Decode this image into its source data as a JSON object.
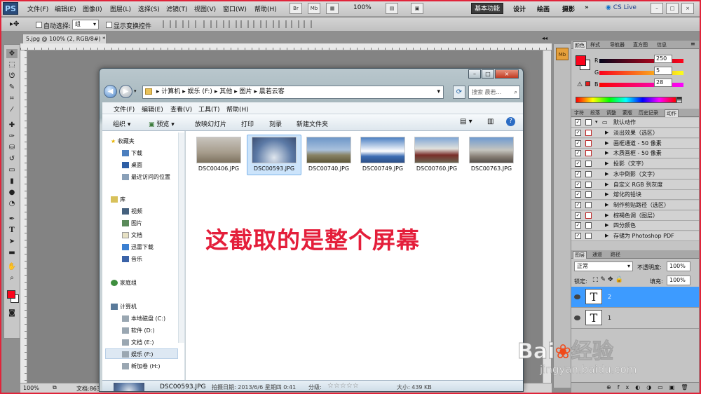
{
  "app": {
    "logo": "PS",
    "menu": [
      "文件(F)",
      "编辑(E)",
      "图像(I)",
      "图层(L)",
      "选择(S)",
      "滤镜(T)",
      "视图(V)",
      "窗口(W)",
      "帮助(H)"
    ],
    "mini_buttons": [
      "Br",
      "Mb"
    ],
    "zoom": "100%",
    "workspaces": [
      "基本功能",
      "设计",
      "绘画",
      "摄影"
    ],
    "more": "»",
    "cslive": "CS Live",
    "window_controls": [
      "–",
      "□",
      "×"
    ]
  },
  "options": {
    "auto_select_label": "自动选择:",
    "auto_select_value": "组",
    "show_transform_label": "显示变换控件"
  },
  "document": {
    "tab_title": "5.jpg @ 100% (2, RGB/8#) *",
    "zoom": "100%",
    "doc_info": "文档:863"
  },
  "explorer": {
    "breadcrumb": [
      "计算机",
      "娱乐 (F:)",
      "其他",
      "图片",
      "晨若云客"
    ],
    "search_placeholder": "搜索 晨若...",
    "menu": [
      "文件(F)",
      "编辑(E)",
      "查看(V)",
      "工具(T)",
      "帮助(H)"
    ],
    "toolbar": [
      "组织 ▾",
      "预览 ▾",
      "放映幻灯片",
      "打印",
      "刻录",
      "新建文件夹"
    ],
    "nav": {
      "favorites": "收藏夹",
      "favorites_items": [
        "下载",
        "桌面",
        "最近访问的位置"
      ],
      "libraries": "库",
      "libraries_items": [
        "视频",
        "图片",
        "文档",
        "迅雷下载",
        "音乐"
      ],
      "homegroup": "家庭组",
      "computer": "计算机",
      "computer_items": [
        "本地磁盘 (C:)",
        "软件 (D:)",
        "文档 (E:)",
        "娱乐 (F:)",
        "新加卷 (H:)"
      ]
    },
    "files": [
      "DSC00406.JPG",
      "DSC00593.JPG",
      "DSC00740.JPG",
      "DSC00749.JPG",
      "DSC00760.JPG",
      "DSC00763.JPG"
    ],
    "selected_file": "DSC00593.JPG",
    "details": {
      "name": "DSC00593.JPG",
      "date_label": "拍摄日期: 2013/6/6 星期四 0:41",
      "rating_label": "分级:",
      "stars": "☆☆☆☆☆",
      "size_label": "大小: 439 KB"
    }
  },
  "overlay_text": "这截取的是整个屏幕",
  "panels": {
    "color_tabs": [
      "颜色",
      "样式",
      "导航器",
      "直方图",
      "信息"
    ],
    "rgb": [
      {
        "label": "R",
        "value": "250"
      },
      {
        "label": "G",
        "value": "5"
      },
      {
        "label": "B",
        "value": "28"
      }
    ],
    "actions_tabs": [
      "字符",
      "段落",
      "调整",
      "蒙版",
      "历史记录",
      "动作"
    ],
    "actions_set": "默认动作",
    "actions": [
      "淡出效果（选区）",
      "画框通道 - 50 像素",
      "木质画框 - 50 像素",
      "投影（文字）",
      "水中倒影（文字）",
      "自定义 RGB 到灰度",
      "熔化的铅块",
      "制作剪贴路径（选区）",
      "棕褐色调（图层）",
      "四分颜色",
      "存储为 Photoshop PDF"
    ],
    "layers_tabs": [
      "图层",
      "通道",
      "路径"
    ],
    "blend_mode": "正常",
    "opacity_label": "不透明度:",
    "opacity": "100%",
    "lock_label": "锁定:",
    "fill_label": "填充:",
    "fill": "100%",
    "layers": [
      {
        "thumb": "T",
        "name": "2"
      },
      {
        "thumb": "T",
        "name": "1"
      }
    ]
  },
  "watermark": {
    "brand": "Bai",
    "brand2": "经验",
    "url": "jingyan.baidu.com"
  },
  "colors": {
    "foreground": "#fa051c",
    "selection": "#3d9bff",
    "accent_red": "#e41e3a"
  }
}
